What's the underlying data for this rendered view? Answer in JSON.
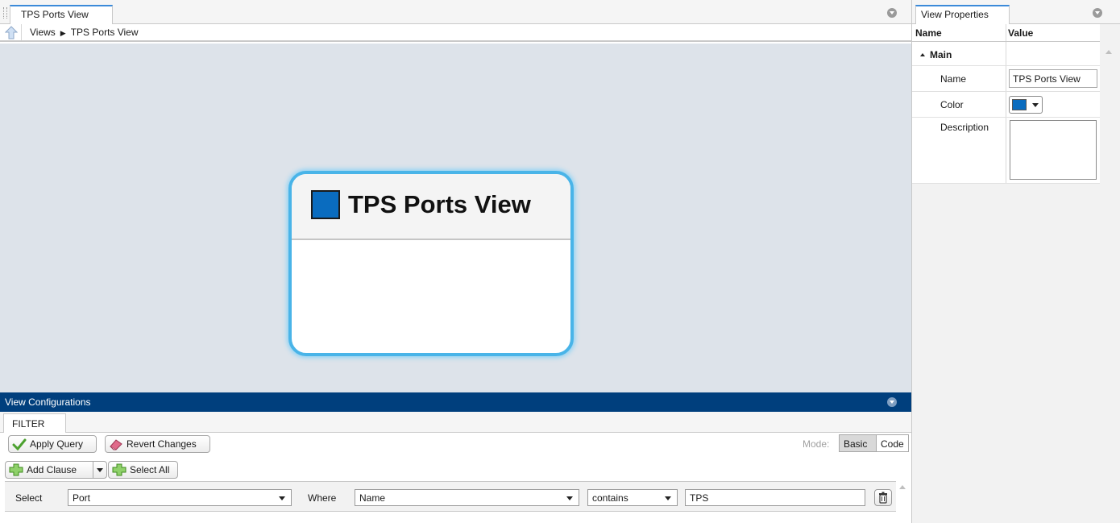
{
  "editor": {
    "tab_title": "TPS Ports View",
    "breadcrumb": {
      "root": "Views",
      "current": "TPS Ports View"
    }
  },
  "canvas": {
    "view_title": "TPS Ports View",
    "view_color": "#0a6cbf"
  },
  "view_configurations": {
    "title": "View Configurations",
    "tab": "FILTER",
    "apply_label": "Apply Query",
    "revert_label": "Revert Changes",
    "mode_label": "Mode:",
    "mode_basic": "Basic",
    "mode_code": "Code",
    "add_clause_label": "Add Clause",
    "select_all_label": "Select All",
    "clause": {
      "select_label": "Select",
      "select_value": "Port",
      "where_label": "Where",
      "where_value": "Name",
      "operator_value": "contains",
      "value": "TPS"
    }
  },
  "properties": {
    "panel_title": "View Properties",
    "col_name": "Name",
    "col_value": "Value",
    "group": "Main",
    "rows": {
      "name_label": "Name",
      "name_value": "TPS Ports View",
      "color_label": "Color",
      "color_value": "#0a6cbf",
      "description_label": "Description",
      "description_value": ""
    }
  },
  "icons": {
    "collapse": "chevron-down-circle-icon",
    "up": "up-arrow-icon",
    "apply": "checkmark-icon",
    "revert": "eraser-icon",
    "add": "green-plus-icon",
    "delete": "trash-icon"
  },
  "colors": {
    "accent": "#3b8ad9",
    "vc_header": "#003f7d",
    "canvas_bg": "#dde3ea",
    "view_border": "#49b4e8"
  }
}
